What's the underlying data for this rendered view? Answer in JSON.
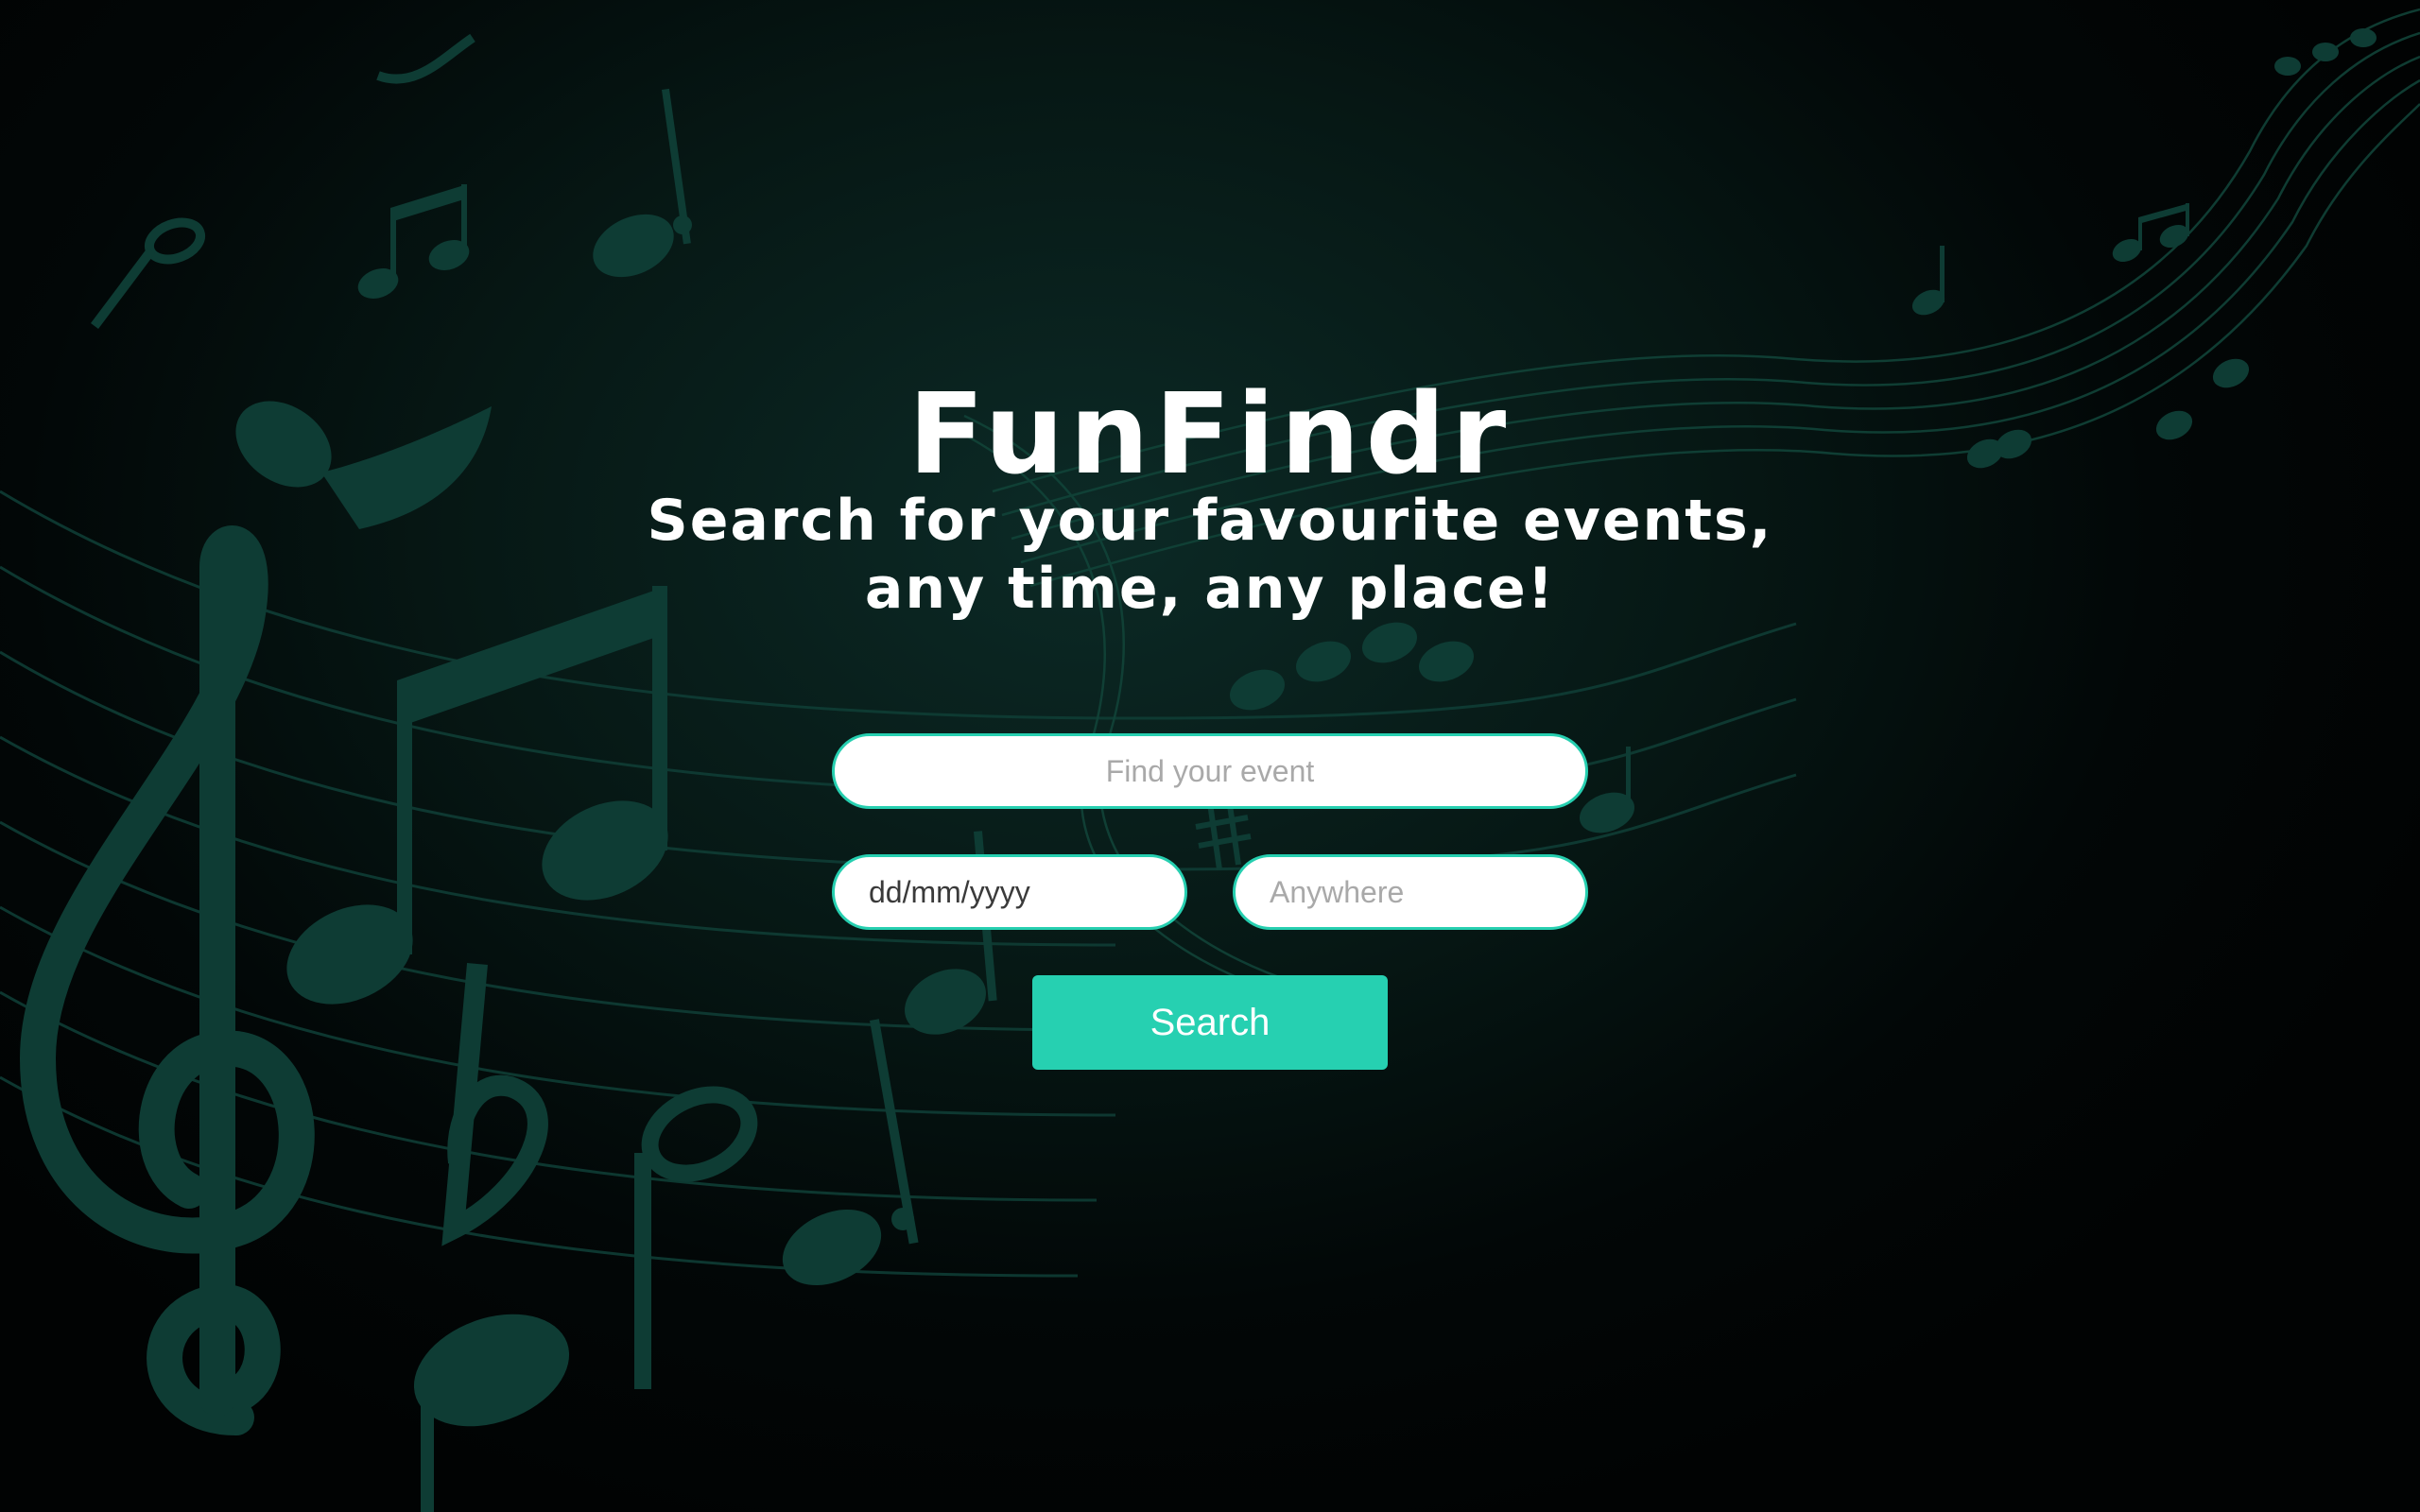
{
  "brand": {
    "title": "FunFindr"
  },
  "tagline": {
    "line1": "Search for your favourite events,",
    "line2": "any time, any place!"
  },
  "search_form": {
    "event_placeholder": "Find your event",
    "date_value": "dd/mm/yyyy",
    "location_placeholder": "Anywhere",
    "submit_label": "Search"
  },
  "background": {
    "theme": "music-notes",
    "icons": [
      "treble-clef-icon",
      "eighth-note-icon",
      "beamed-notes-icon",
      "flat-icon",
      "half-note-icon",
      "sharp-icon",
      "staff-lines"
    ]
  },
  "colors": {
    "accent": "#26d0b1",
    "background_dark": "#020707",
    "background_glow": "#0c2a26",
    "notes": "#0f3d35",
    "text": "#ffffff"
  }
}
